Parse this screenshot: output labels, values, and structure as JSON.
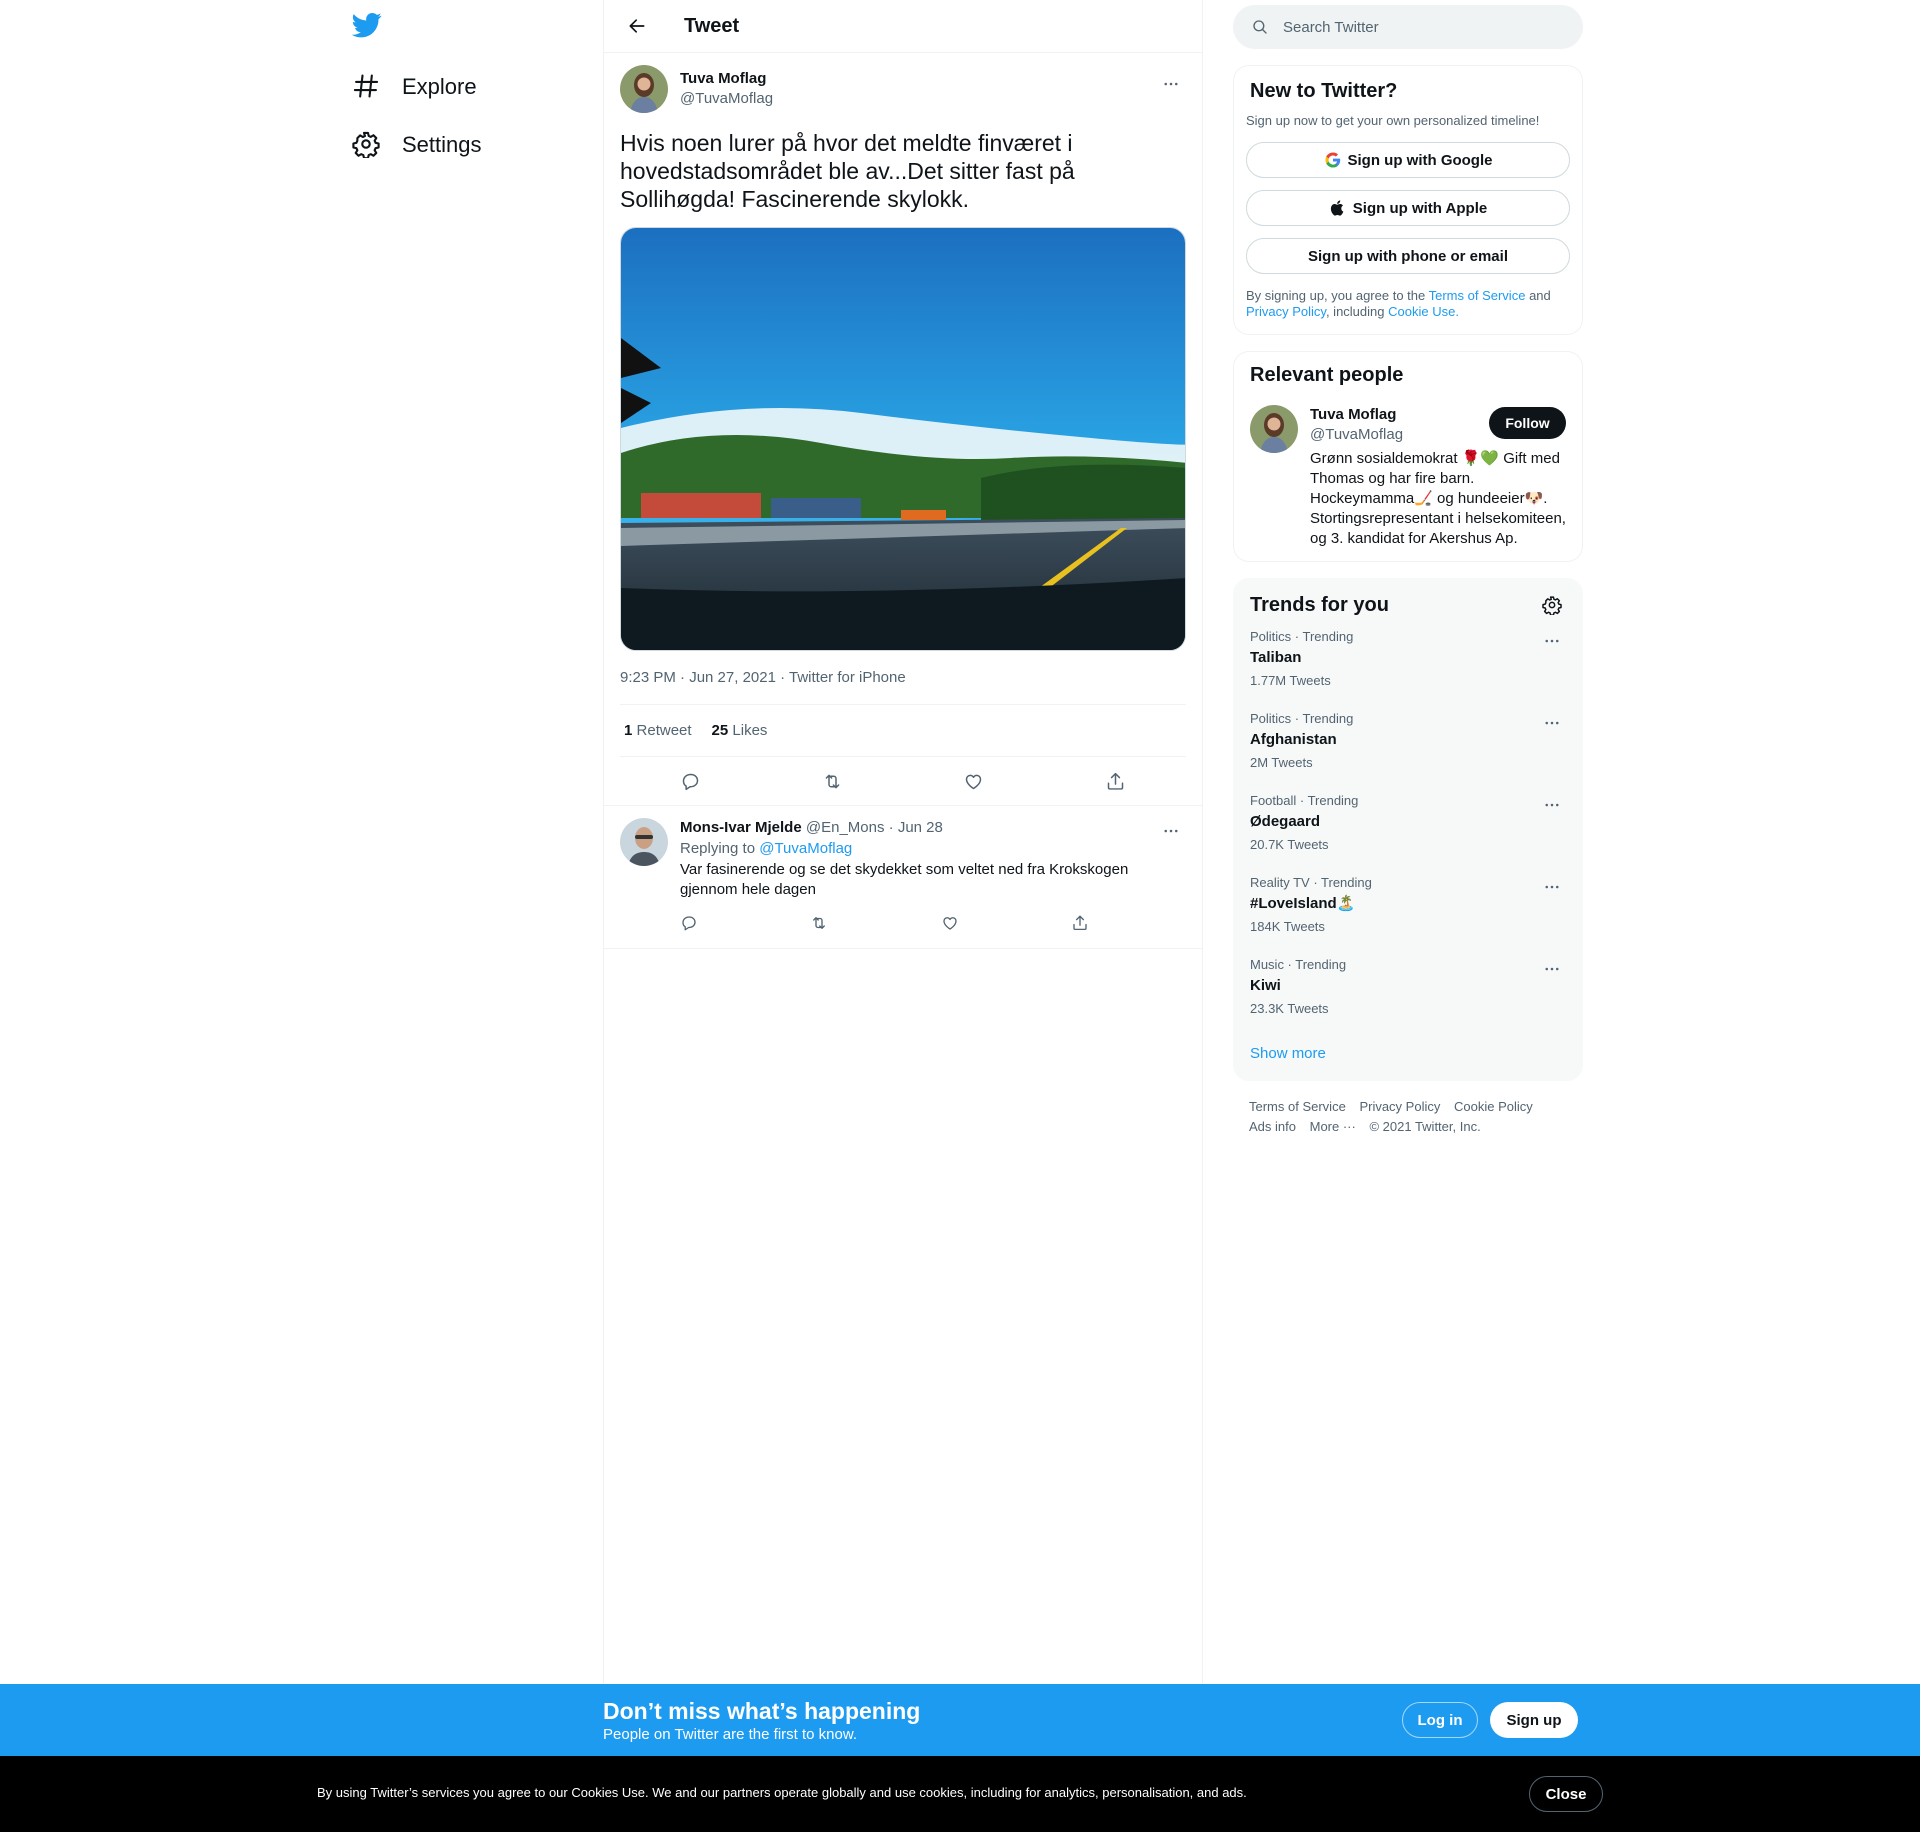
{
  "colors": {
    "brand": "#1d9bf0",
    "text": "#0f1419",
    "secondary": "#536471"
  },
  "nav": {
    "logo_icon": "twitter-bird-icon",
    "items": [
      {
        "label": "Explore",
        "icon": "hashtag-icon"
      },
      {
        "label": "Settings",
        "icon": "gear-icon"
      }
    ]
  },
  "header": {
    "title": "Tweet"
  },
  "tweet": {
    "author_name": "Tuva Moflag",
    "author_handle": "@TuvaMoflag",
    "text": "Hvis noen lurer på hvor det meldte finværet i hovedstadsområdet ble av...Det sitter fast på Sollihøgda! Fascinerende skylokk.",
    "meta": "9:23 PM · Jun 27, 2021 · Twitter for iPhone",
    "retweets_count": "1",
    "retweets_label": "Retweet",
    "likes_count": "25",
    "likes_label": "Likes"
  },
  "reply": {
    "author_name": "Mons-Ivar Mjelde",
    "author_handle": "@En_Mons",
    "date": "· Jun 28",
    "replying_prefix": "Replying to",
    "replying_to": "@TuvaMoflag",
    "text": "Var fasinerende og se det skydekket som veltet ned fra Krokskogen gjennom hele dagen"
  },
  "search": {
    "placeholder": "Search Twitter"
  },
  "signup": {
    "title": "New to Twitter?",
    "subtitle": "Sign up now to get your own personalized timeline!",
    "google": "Sign up with Google",
    "apple": "Sign up with Apple",
    "phone": "Sign up with phone or email",
    "legal_1": "By signing up, you agree to the",
    "terms": "Terms of Service",
    "legal_2": "and",
    "privacy": "Privacy Policy",
    "legal_3": ", including",
    "cookie": "Cookie Use."
  },
  "people": {
    "title": "Relevant people",
    "name": "Tuva Moflag",
    "handle": "@TuvaMoflag",
    "follow": "Follow",
    "bio": "Grønn sosialdemokrat 🌹💚 Gift med Thomas og har fire barn. Hockeymamma🏒 og hundeeier🐶. Stortingsrepresentant i helsekomiteen, og 3. kandidat for Akershus Ap."
  },
  "trends": {
    "title": "Trends for you",
    "items": [
      {
        "context": "Politics · Trending",
        "name": "Taliban",
        "count": "1.77M Tweets"
      },
      {
        "context": "Politics · Trending",
        "name": "Afghanistan",
        "count": "2M Tweets"
      },
      {
        "context": "Football · Trending",
        "name": "Ødegaard",
        "count": "20.7K Tweets"
      },
      {
        "context": "Reality TV · Trending",
        "name": "#LoveIsland🏝️",
        "count": "184K Tweets"
      },
      {
        "context": "Music · Trending",
        "name": "Kiwi",
        "count": "23.3K Tweets"
      }
    ],
    "show_more": "Show more"
  },
  "footer": {
    "terms": "Terms of Service",
    "privacy": "Privacy Policy",
    "cookie": "Cookie Policy",
    "ads": "Ads info",
    "more": "More ···",
    "copyright": "© 2021 Twitter, Inc."
  },
  "bottom_bar": {
    "title": "Don’t miss what’s happening",
    "subtitle": "People on Twitter are the first to know.",
    "login": "Log in",
    "signup": "Sign up"
  },
  "cookie_bar": {
    "text": "By using Twitter’s services you agree to our Cookies Use. We and our partners operate globally and use cookies, including for analytics, personalisation, and ads.",
    "close": "Close"
  }
}
